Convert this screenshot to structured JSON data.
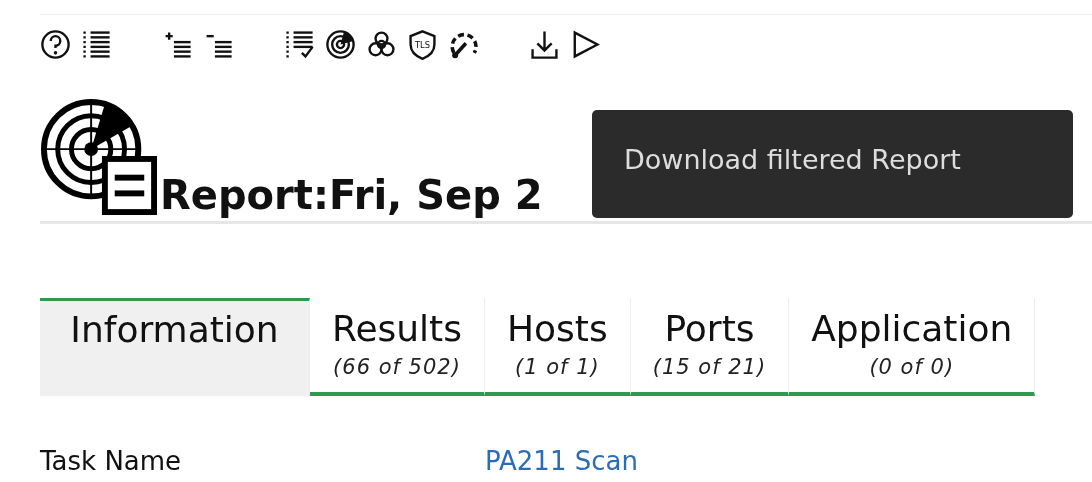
{
  "toolbar": [
    {
      "kind": "help"
    },
    {
      "kind": "list"
    },
    {
      "kind": "list-plus"
    },
    {
      "kind": "list-minus"
    },
    {
      "kind": "checklist"
    },
    {
      "kind": "radar"
    },
    {
      "kind": "biohazard"
    },
    {
      "kind": "tls",
      "label": "TLS"
    },
    {
      "kind": "gauge"
    },
    {
      "kind": "download"
    },
    {
      "kind": "play"
    }
  ],
  "heading": {
    "title": "Report:Fri, Sep 2"
  },
  "tooltip": {
    "text": "Download filtered Report"
  },
  "tabs": [
    {
      "label": "Information",
      "selected": true
    },
    {
      "label": "Results",
      "count": "(66 of 502)",
      "selected": false
    },
    {
      "label": "Hosts",
      "count": "(1 of 1)",
      "selected": false
    },
    {
      "label": "Ports",
      "count": "(15 of 21)",
      "selected": false
    },
    {
      "label": "Application",
      "count": "(0 of 0)",
      "selected": false
    }
  ],
  "details": [
    {
      "label": "Task Name",
      "value": "PA211 Scan"
    }
  ]
}
